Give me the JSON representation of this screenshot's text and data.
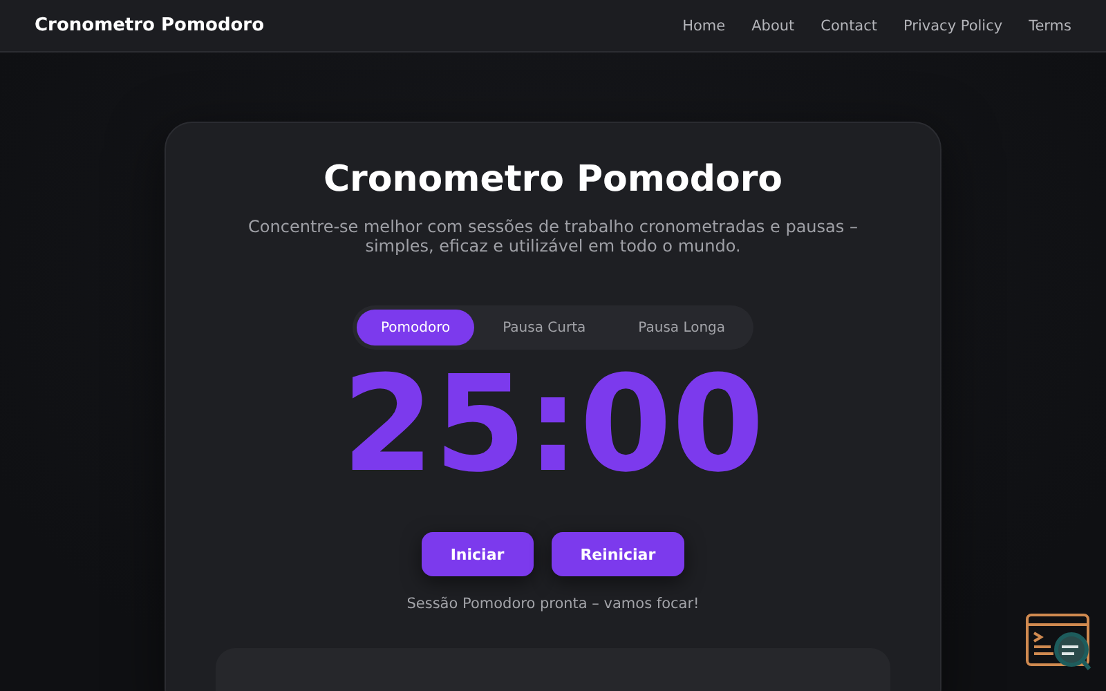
{
  "header": {
    "brand": "Cronometro Pomodoro",
    "nav": [
      "Home",
      "About",
      "Contact",
      "Privacy Policy",
      "Terms"
    ]
  },
  "card": {
    "title": "Cronometro Pomodoro",
    "subtitle": "Concentre-se melhor com sessões de trabalho cronometradas e pausas – simples, eficaz e utilizável em todo o mundo.",
    "tabs": [
      {
        "label": "Pomodoro",
        "selected": true
      },
      {
        "label": "Pausa Curta",
        "selected": false
      },
      {
        "label": "Pausa Longa",
        "selected": false
      }
    ],
    "timer": "25:00",
    "buttons": [
      "Iniciar",
      "Reiniciar"
    ],
    "status": "Sessão Pomodoro pronta – vamos focar!"
  }
}
